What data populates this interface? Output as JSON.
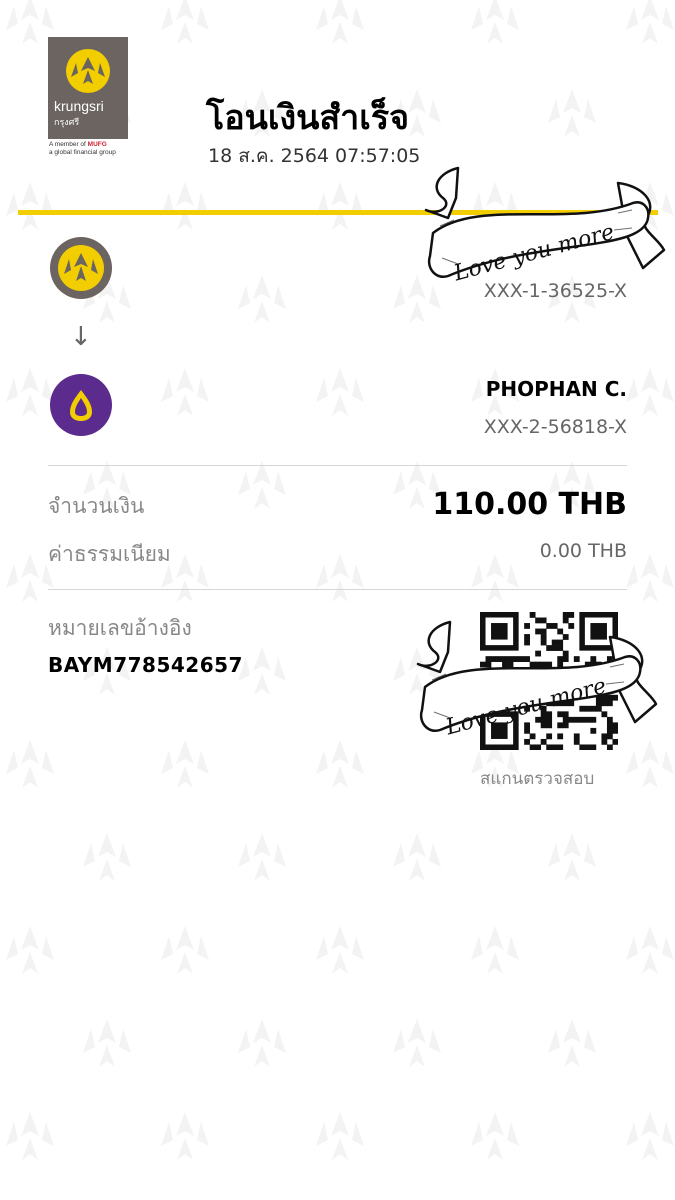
{
  "header": {
    "brand": "krungsri",
    "brand_thai": "กรุงศรี",
    "tagline_prefix": "A member of",
    "tagline_brand": "MUFG",
    "tagline_line2": "a global financial group",
    "title": "โอนเงินสำเร็จ",
    "datetime": "18 ส.ค. 2564 07:57:05"
  },
  "sender": {
    "account": "XXX-1-36525-X",
    "bank_icon": "krungsri-logo-icon"
  },
  "receiver": {
    "name": "PHOPHAN C.",
    "account": "XXX-2-56818-X",
    "bank_icon": "scb-logo-icon"
  },
  "amount": {
    "label": "จำนวนเงิน",
    "value": "110.00 THB"
  },
  "fee": {
    "label": "ค่าธรรมเนียม",
    "value": "0.00 THB"
  },
  "reference": {
    "label": "หมายเลขอ้างอิง",
    "value": "BAYM778542657"
  },
  "qr": {
    "scan_label": "สแกนตรวจสอบ"
  },
  "stickers": {
    "text": "Love you more"
  },
  "colors": {
    "accent": "#f2cd00",
    "krungsri_gray": "#6b6461",
    "scb_purple": "#5b2c8d"
  }
}
